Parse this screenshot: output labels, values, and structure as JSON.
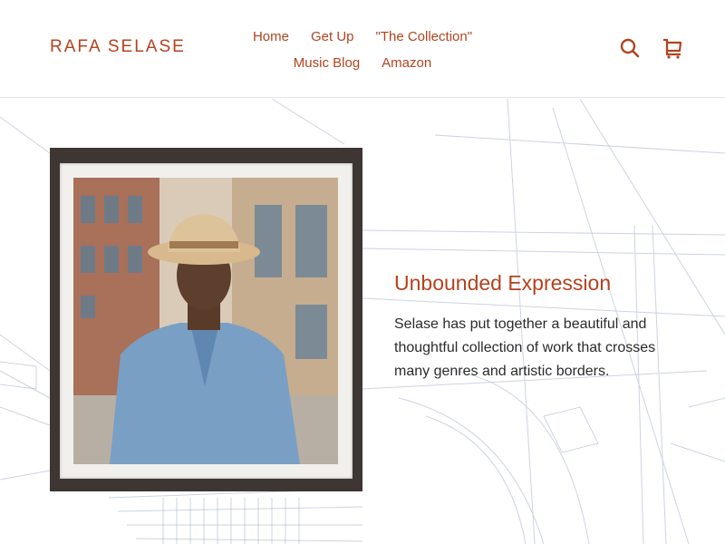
{
  "brand": {
    "name": "RAFA SELASE",
    "color": "#b3431f"
  },
  "nav": {
    "row1": [
      "Home",
      "Get Up",
      "\"The Collection\""
    ],
    "row2": [
      "Music Blog",
      "Amazon"
    ]
  },
  "header_icons": {
    "search": "search-icon",
    "cart": "cart-icon"
  },
  "feature": {
    "heading": "Unbounded Expression",
    "body": "Selase has put together a beautiful and thoughtful collection of work that crosses many genres and artistic borders."
  },
  "photo": {
    "subject": "portrait-photo"
  }
}
